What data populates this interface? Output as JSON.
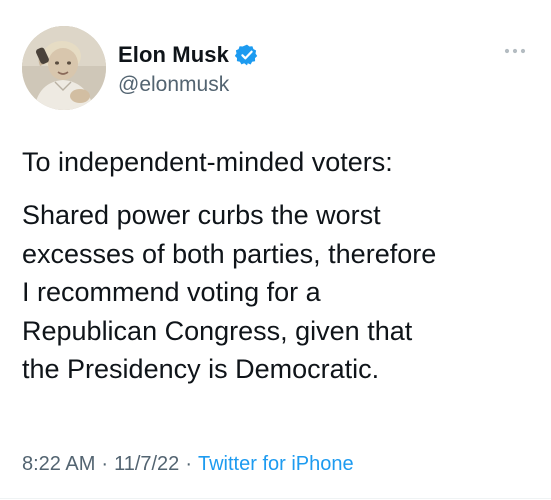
{
  "author": {
    "display_name": "Elon Musk",
    "handle": "@elonmusk",
    "verified": true,
    "avatar_icon": "profile-photo",
    "verified_icon": "verified-badge-icon"
  },
  "more_icon": "more-horizontal-icon",
  "tweet": {
    "paragraphs": [
      "To independent-minded voters:",
      "Shared power curbs the worst\nexcesses of both parties, therefore\nI recommend voting for a\nRepublican Congress, given that\nthe Presidency is Democratic."
    ]
  },
  "meta": {
    "time": "8:22 AM",
    "separator": "·",
    "date": "11/7/22",
    "source": "Twitter for iPhone"
  },
  "colors": {
    "text": "#0f1419",
    "secondary": "#536471",
    "accent": "#1d9bf0"
  }
}
